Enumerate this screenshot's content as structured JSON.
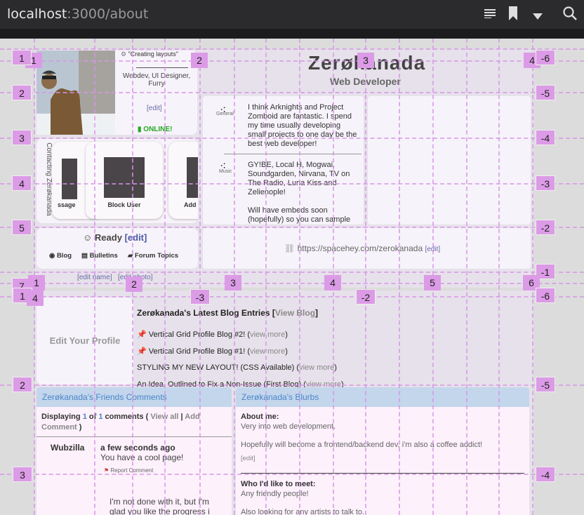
{
  "browser": {
    "url_host": "localhost",
    "url_path": ":3000/about",
    "icons": [
      "reader-icon",
      "bookmark-icon",
      "dropdown-icon",
      "search-icon"
    ]
  },
  "profile": {
    "name": "Zerøkanada",
    "tagline": "Web Developer",
    "layout_label": "\"Creating layouts\"",
    "roles": "Webdev, UI Designer, Furry",
    "edit": "[edit]",
    "online": "ONLINE!",
    "status_label": "Ready",
    "status_edit": "[edit]",
    "url": "https://spacehey.com/zerokanada",
    "url_edit": "[edit]",
    "edit_name": "[edit name]",
    "edit_photo": "[edit photo]"
  },
  "contacting": {
    "title": "Contacting Zerøkanada",
    "cards": [
      "ssage",
      "Block User",
      "Add"
    ]
  },
  "links": [
    "Blog",
    "Bulletins",
    "Forum Topics"
  ],
  "interests": [
    {
      "icon": "General",
      "text": "I think Arknights and Project Zomboid are fantastic. I spend my time usually developing small projects to one day be the best web developer!"
    },
    {
      "icon": "Music",
      "text": "GY!BE, Local H, Mogwai, Soundgarden, Nirvana, TV on The Radio, Luna Kiss and Zelienople!",
      "text2": "Will have embeds soon (hopefully) so you can sample"
    }
  ],
  "edit_profile": "Edit Your Profile",
  "blog": {
    "title": "Zerøkanada's Latest Blog Entries [",
    "view_blog": "View Blog",
    "close": "]",
    "entries": [
      {
        "pin": true,
        "title": "Vertical Grid Profile Blog #2!",
        "more": "view more"
      },
      {
        "pin": true,
        "title": "Vertical Grid Profile Blog #1!",
        "more": "view more"
      },
      {
        "pin": false,
        "title": "STYLING MY NEW LAYOUT! (CSS Available)",
        "more": "view more"
      },
      {
        "pin": false,
        "title": "An Idea, Outlined to Fix a Non-Issue (First Blog)",
        "more": "view more"
      }
    ]
  },
  "comments": {
    "header": "Zerøkanada's Friends Comments",
    "displaying": "Displaying",
    "shown": "1",
    "of": "of",
    "total": "1",
    "comments_word": "comments (",
    "view_all": "View all",
    "add": "Add Comment",
    "close": ")",
    "author": "Wubzilla",
    "time": "a few seconds ago",
    "body": "You have a cool page!",
    "report": "Report Comment",
    "reply": "I'm not done with it, but I'm glad you like the progress i"
  },
  "blurbs": {
    "header": "Zerøkanada's Blurbs",
    "about_title": "About me:",
    "about_1": "Very into web development.",
    "about_2": "Hopefully will become a frontend/backend dev, i'm also a coffee addict!",
    "edit": "[edit]",
    "meet_title": "Who I'd like to meet:",
    "meet_1": "Any friendly people!",
    "meet_2": "Also looking for any artists to talk to."
  },
  "grid_labels": {
    "top_row": [
      "1",
      "2",
      "3",
      "4"
    ],
    "top_row_right": "-6",
    "left_col": [
      "1",
      "2",
      "3",
      "4",
      "5"
    ],
    "right_col": [
      "-5",
      "-4",
      "-3",
      "-2",
      "-1"
    ],
    "mid_row": [
      "7",
      "1",
      "2",
      "-3",
      "3",
      "4",
      "-2",
      "5",
      "6",
      "-1"
    ],
    "second_row": [
      "1",
      "4",
      "-6"
    ],
    "lower_left": [
      "2",
      "3"
    ],
    "lower_right": [
      "-5",
      "-4"
    ]
  },
  "colors": {
    "accent": "#dc9be6",
    "brand_link": "#4a86c7",
    "online": "#22aa22"
  }
}
